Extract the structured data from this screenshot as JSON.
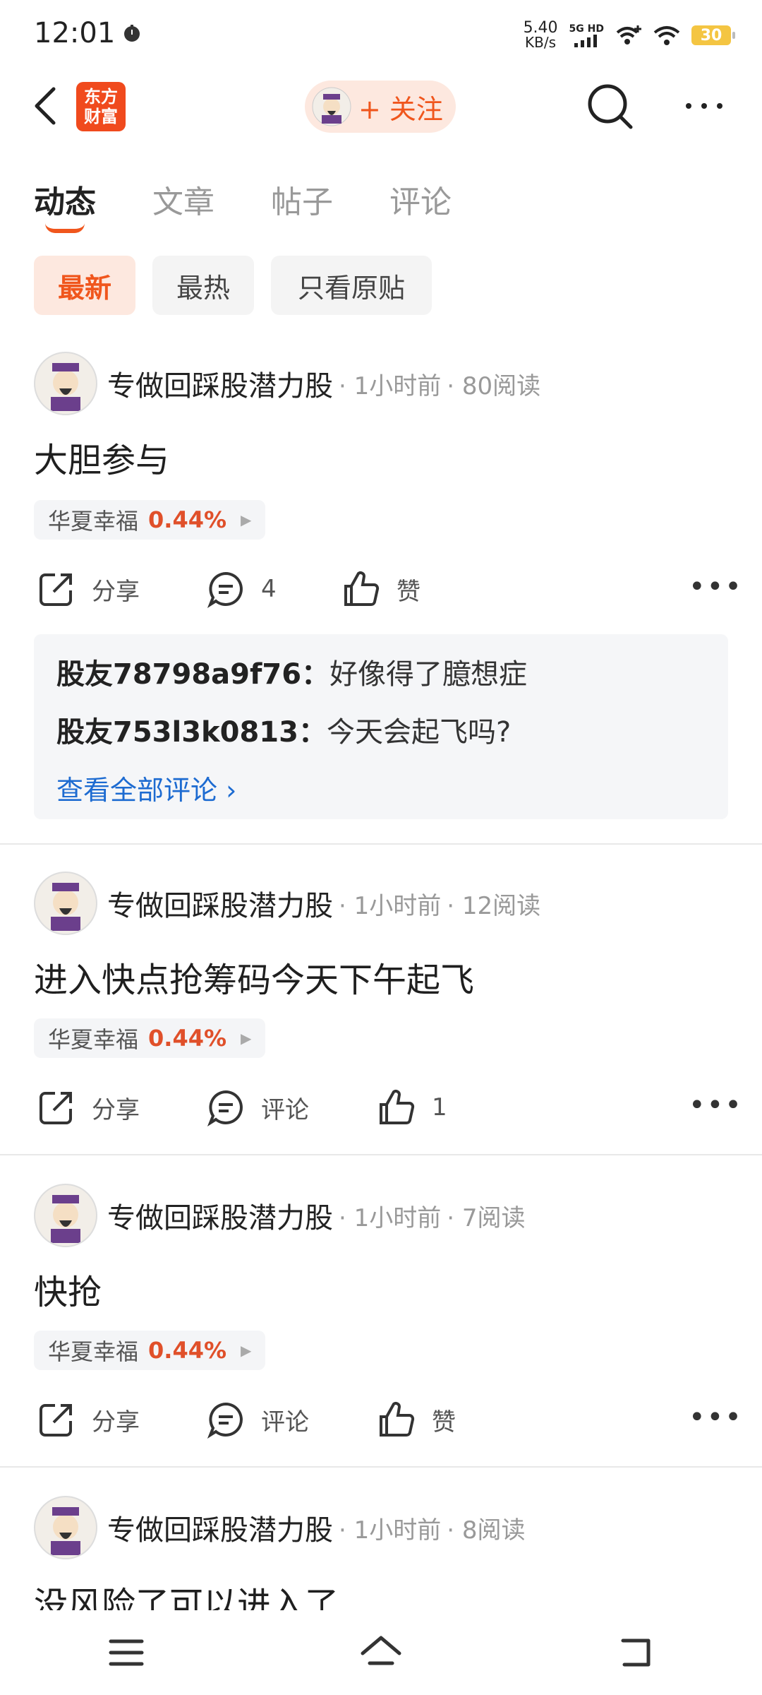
{
  "status_bar": {
    "time": "12:01",
    "net_speed": "5.40",
    "net_unit": "KB/s",
    "network": "5G HD",
    "battery": "30"
  },
  "header": {
    "logo_line1": "东方",
    "logo_line2": "财富",
    "follow_label": "+ 关注"
  },
  "tabs": [
    "动态",
    "文章",
    "帖子",
    "评论"
  ],
  "filters": [
    "最新",
    "最热",
    "只看原贴"
  ],
  "posts": [
    {
      "author": "专做回踩股潜力股",
      "time": "· 1小时前",
      "reads": "· 80阅读",
      "title": "大胆参与",
      "stock": "华夏幸福",
      "change": "0.44%",
      "share": "分享",
      "comment": "4",
      "like": "赞",
      "comments": [
        {
          "user": "股友78798a9f76",
          "text": "好像得了臆想症"
        },
        {
          "user": "股友753l3k0813",
          "text": "今天会起飞吗?"
        }
      ],
      "see_all": "查看全部评论 ›"
    },
    {
      "author": "专做回踩股潜力股",
      "time": "· 1小时前",
      "reads": "· 12阅读",
      "title": "进入快点抢筹码今天下午起飞",
      "stock": "华夏幸福",
      "change": "0.44%",
      "share": "分享",
      "comment": "评论",
      "like": "1"
    },
    {
      "author": "专做回踩股潜力股",
      "time": "· 1小时前",
      "reads": "· 7阅读",
      "title": "快抢",
      "stock": "华夏幸福",
      "change": "0.44%",
      "share": "分享",
      "comment": "评论",
      "like": "赞"
    },
    {
      "author": "专做回踩股潜力股",
      "time": "· 1小时前",
      "reads": "· 8阅读",
      "title": "没风险了可以进入了"
    }
  ],
  "colors": {
    "accent": "#f0561d",
    "link": "#1d6bd1",
    "pct": "#e0502a"
  }
}
